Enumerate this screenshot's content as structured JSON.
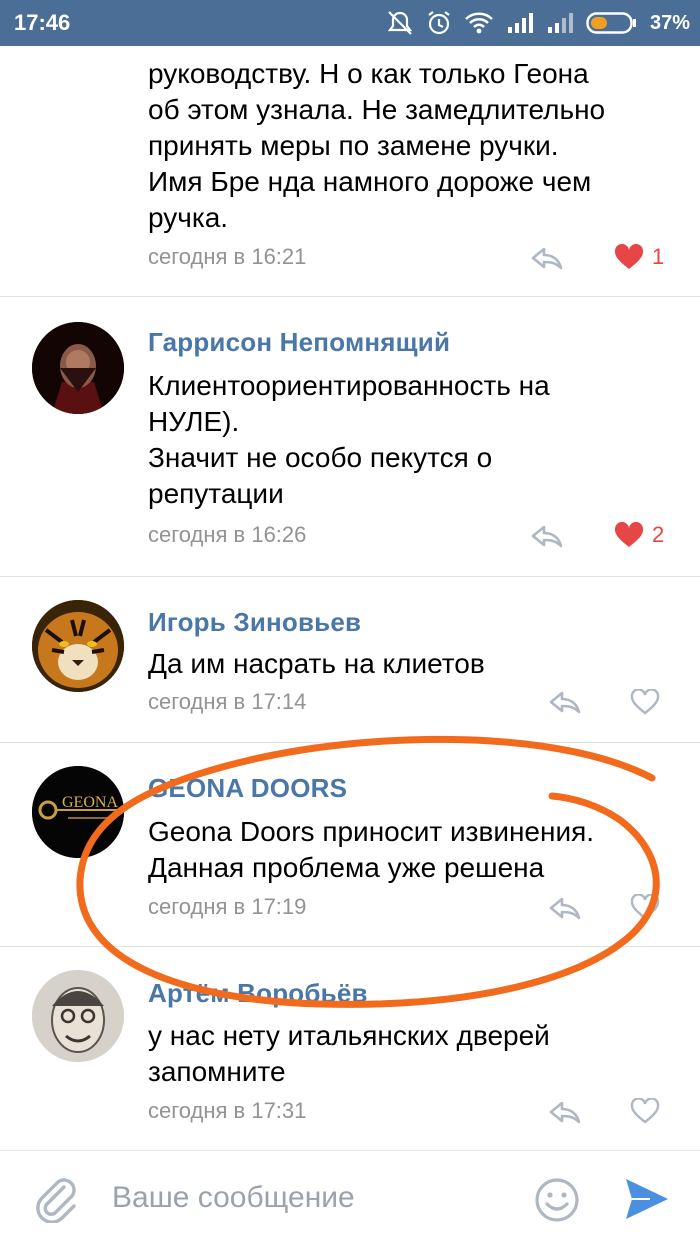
{
  "status_bar": {
    "time": "17:46",
    "battery": "37%"
  },
  "comments": [
    {
      "author": "",
      "text": "руководству. Н о как только Геона\nоб этом узнала. Не замедлительно\nпринять меры по замене ручки.\nИмя Бре нда намного дороже чем\nручка.",
      "time": "сегодня в 16:21",
      "liked": true,
      "likes": "1"
    },
    {
      "author": "Гаррисон Непомнящий",
      "text": "Клиентоориентированность на\nНУЛЕ).\nЗначит не особо пекутся о\nрепутации",
      "time": "сегодня в 16:26",
      "liked": true,
      "likes": "2"
    },
    {
      "author": "Игорь Зиновьев",
      "text": "Да им насрать на клиетов",
      "time": "сегодня в 17:14",
      "liked": false,
      "likes": ""
    },
    {
      "author": "GEONA DOORS",
      "text": "Geona Doors приносит извинения.\nДанная проблема уже решена",
      "time": "сегодня в 17:19",
      "liked": false,
      "likes": "",
      "avatar_text": "GEONA"
    },
    {
      "author": "Артём Воробьёв",
      "text": "у нас нету итальянских дверей\nзапомните",
      "time": "сегодня в 17:31",
      "liked": false,
      "likes": ""
    }
  ],
  "composer": {
    "placeholder": "Ваше сообщение"
  },
  "colors": {
    "status_bar": "#4a6e96",
    "author": "#4a76a8",
    "timestamp": "#939393",
    "like_active": "#e64646",
    "icon_gray": "#aeb7c2",
    "send": "#4a8fe0",
    "annotation": "#f26b1d"
  }
}
